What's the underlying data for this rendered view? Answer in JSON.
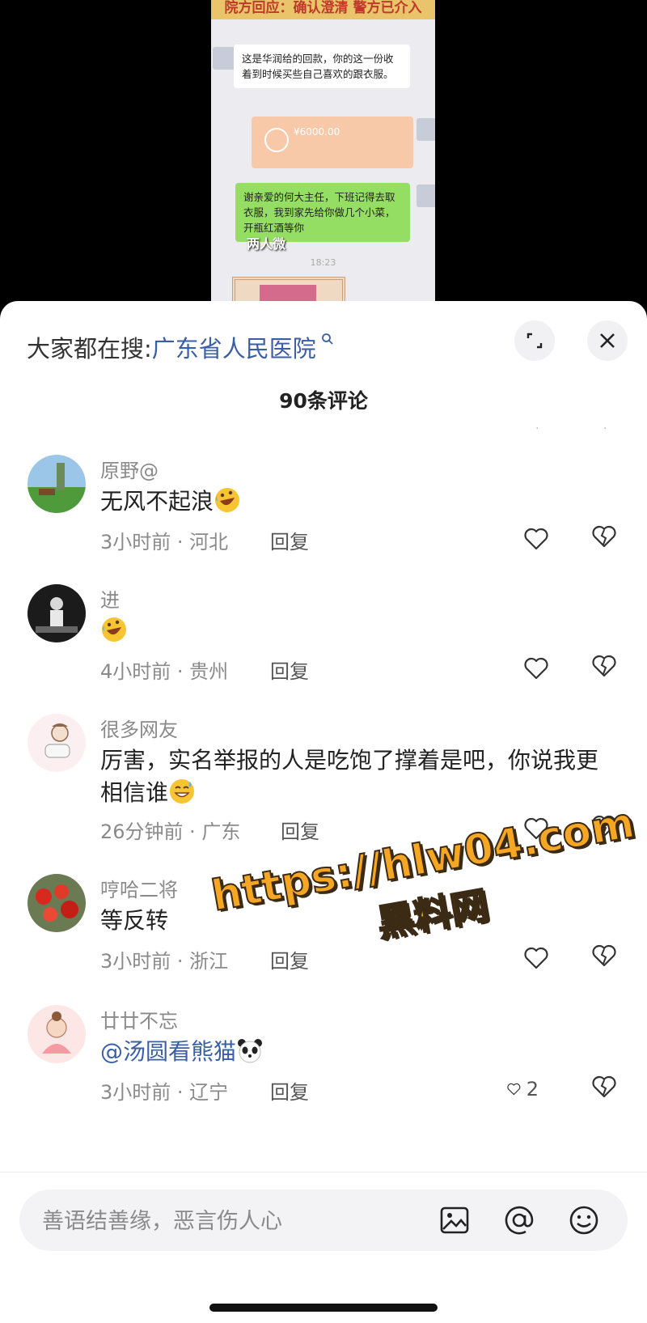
{
  "video": {
    "caption": "院方回应：确认澄清 警方已介入",
    "chat_left": "这是华润给的回款，你的这一份收着到时候买些自己喜欢的跟衣服。",
    "transfer_amount": "¥6000.00",
    "chat_right": "谢亲爱的何大主任，下班记得去取衣服，我到家先给你做几个小菜，开瓶红酒等你",
    "overlay_note": "两人微",
    "time": "18:23"
  },
  "sheet": {
    "search_label": "大家都在搜:",
    "search_keyword": "广东省人民医院",
    "search_icon": "search-icon",
    "title": "90条评论",
    "dots": "·"
  },
  "comments": [
    {
      "user": "原野@",
      "text": "无风不起浪",
      "emoji": "rolling-laugh",
      "meta": "3小时前 · 河北",
      "reply": "回复",
      "likes": ""
    },
    {
      "user": "进",
      "text": "",
      "emoji": "rolling-laugh",
      "meta": "4小时前 · 贵州",
      "reply": "回复",
      "likes": ""
    },
    {
      "user": "很多网友",
      "text": "厉害，实名举报的人是吃饱了撑着是吧，你说我更相信谁",
      "emoji": "sweat-smile",
      "meta": "26分钟前 · 广东",
      "reply": "回复",
      "likes": ""
    },
    {
      "user": "哼哈二将",
      "text": "等反转",
      "emoji": "",
      "meta": "3小时前 · 浙江",
      "reply": "回复",
      "likes": ""
    },
    {
      "user": "廿廿不忘",
      "text": "@汤圆看熊猫",
      "emoji": "panda",
      "meta": "3小时前 · 辽宁",
      "reply": "回复",
      "likes": "2"
    }
  ],
  "watermark": {
    "url": "https://hlw04.com",
    "site": "黑料网"
  },
  "input": {
    "placeholder": "善语结善缘，恶言伤人心"
  },
  "colors": {
    "keyword": "#3a5fa6",
    "meta": "#8a8a8a",
    "watermark": "#f5a623"
  }
}
